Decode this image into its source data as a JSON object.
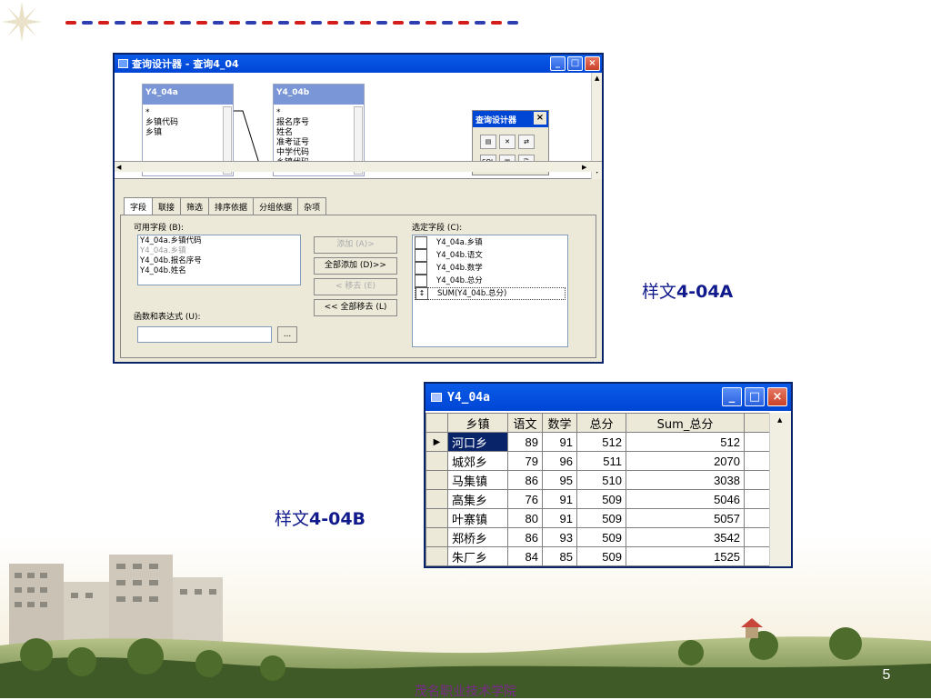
{
  "slide": {
    "footer": "茂名职业技术学院",
    "page_number": "5",
    "caption_a_prefix": "样文",
    "caption_a_code": "4-04A",
    "caption_b_prefix": "样文",
    "caption_b_code": "4-04B"
  },
  "query_designer": {
    "title": "查询设计器 - 查询4_04",
    "table_a": {
      "name": "Y4_04a",
      "fields": [
        "*",
        "乡镇代码",
        "乡镇"
      ]
    },
    "table_b": {
      "name": "Y4_04b",
      "fields": [
        "*",
        "报名序号",
        "姓名",
        "准考证号",
        "中学代码",
        "乡镇代码"
      ]
    },
    "toolbar": {
      "title": "查询设计器",
      "close": "×",
      "sql_label": "SQL"
    },
    "tabs": [
      "字段",
      "联接",
      "筛选",
      "排序依据",
      "分组依据",
      "杂项"
    ],
    "available_label": "可用字段 (B):",
    "available_fields": [
      "Y4_04a.乡镇代码",
      "Y4_04a.乡镇",
      "Y4_04b.报名序号",
      "Y4_04b.姓名"
    ],
    "selected_label": "选定字段 (C):",
    "selected_fields": [
      "Y4_04a.乡镇",
      "Y4_04b.语文",
      "Y4_04b.数学",
      "Y4_04b.总分",
      "SUM(Y4_04b.总分)"
    ],
    "buttons": {
      "add": "添加 (A)>",
      "add_all": "全部添加 (D)>>",
      "remove": "< 移去 (E)",
      "remove_all": "<< 全部移去 (L)"
    },
    "expr_label": "函数和表达式 (U):",
    "expr_value": "",
    "expr_button": "..."
  },
  "datasheet": {
    "title": "Y4_04a",
    "columns": [
      "乡镇",
      "语文",
      "数学",
      "总分",
      "Sum_总分"
    ],
    "rows": [
      [
        "河口乡",
        "89",
        "91",
        "512",
        "512"
      ],
      [
        "城郊乡",
        "79",
        "96",
        "511",
        "2070"
      ],
      [
        "马集镇",
        "86",
        "95",
        "510",
        "3038"
      ],
      [
        "高集乡",
        "76",
        "91",
        "509",
        "5046"
      ],
      [
        "叶寨镇",
        "80",
        "91",
        "509",
        "5057"
      ],
      [
        "郑桥乡",
        "86",
        "93",
        "509",
        "3542"
      ],
      [
        "朱厂乡",
        "84",
        "85",
        "509",
        "1525"
      ]
    ]
  },
  "colors": {
    "caption": "#111a8c",
    "footer": "#7a2a8a",
    "titlebar": "#0046d5",
    "dash_red": "#d41c1c",
    "dash_blue": "#2d3fb0"
  }
}
